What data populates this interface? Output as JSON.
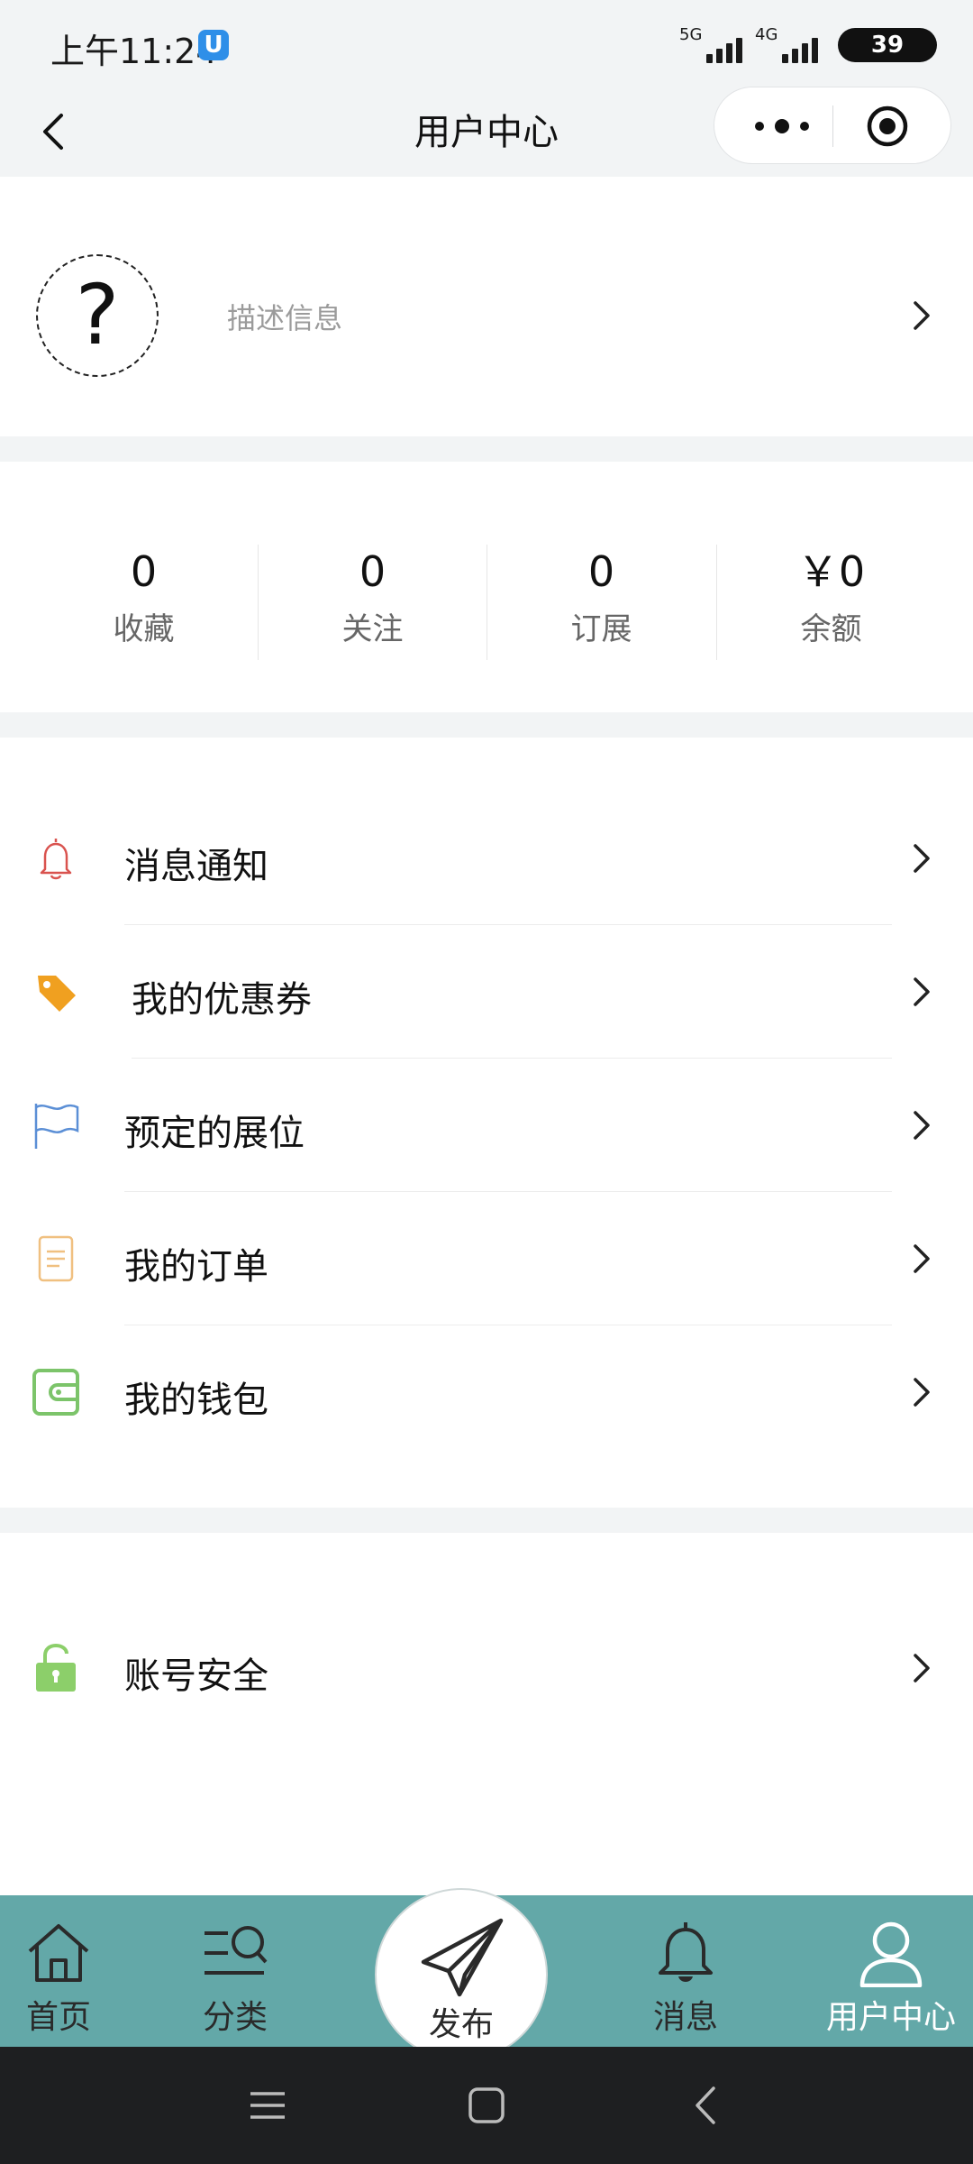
{
  "status_bar": {
    "time": "上午11:24",
    "app_icon_glyph": "U",
    "network_1": "5G",
    "network_2": "4G",
    "battery": "39"
  },
  "nav": {
    "title": "用户中心",
    "back_icon": "chevron-left-icon",
    "more_icon": "more-dots-icon",
    "close_icon": "target-close-icon"
  },
  "profile": {
    "avatar_glyph": "?",
    "description": "描述信息"
  },
  "stats": [
    {
      "value": "0",
      "label": "收藏"
    },
    {
      "value": "0",
      "label": "关注"
    },
    {
      "value": "0",
      "label": "订展"
    },
    {
      "value": "￥0",
      "label": "余额"
    }
  ],
  "menu": [
    {
      "label": "消息通知",
      "icon": "bell-icon"
    },
    {
      "label": "我的优惠券",
      "icon": "tag-icon"
    },
    {
      "label": "预定的展位",
      "icon": "flag-icon"
    },
    {
      "label": "我的订单",
      "icon": "document-icon"
    },
    {
      "label": "我的钱包",
      "icon": "wallet-icon"
    }
  ],
  "security": {
    "label": "账号安全",
    "icon": "lock-icon"
  },
  "tabs": [
    {
      "label": "首页",
      "icon": "home-icon"
    },
    {
      "label": "分类",
      "icon": "category-search-icon"
    },
    {
      "label": "发布",
      "icon": "paper-plane-icon"
    },
    {
      "label": "消息",
      "icon": "bell-icon"
    },
    {
      "label": "用户中心",
      "icon": "user-icon"
    }
  ],
  "colors": {
    "tab_bar": "#63a8a8",
    "bell": "#d9534f",
    "tag": "#f0a020",
    "flag": "#5b8fd6",
    "document": "#f0c080",
    "wallet": "#7cc46a",
    "lock": "#8ccf6a"
  }
}
